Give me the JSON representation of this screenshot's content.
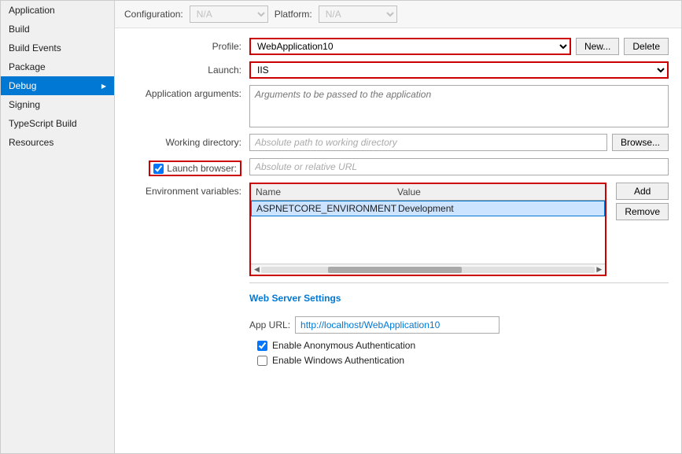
{
  "sidebar": {
    "items": [
      {
        "id": "application",
        "label": "Application",
        "active": false
      },
      {
        "id": "build",
        "label": "Build",
        "active": false
      },
      {
        "id": "build-events",
        "label": "Build Events",
        "active": false
      },
      {
        "id": "package",
        "label": "Package",
        "active": false
      },
      {
        "id": "debug",
        "label": "Debug",
        "active": true
      },
      {
        "id": "signing",
        "label": "Signing",
        "active": false
      },
      {
        "id": "typescript-build",
        "label": "TypeScript Build",
        "active": false
      },
      {
        "id": "resources",
        "label": "Resources",
        "active": false
      }
    ]
  },
  "topbar": {
    "configuration_label": "Configuration:",
    "configuration_value": "N/A",
    "platform_label": "Platform:",
    "platform_value": "N/A"
  },
  "form": {
    "profile_label": "Profile:",
    "profile_value": "WebApplication10",
    "profile_placeholder": "WebApplication10",
    "new_button": "New...",
    "delete_button": "Delete",
    "launch_label": "Launch:",
    "launch_value": "IIS",
    "app_args_label": "Application arguments:",
    "app_args_placeholder": "Arguments to be passed to the application",
    "working_dir_label": "Working directory:",
    "working_dir_placeholder": "Absolute path to working directory",
    "browse_button": "Browse...",
    "launch_browser_label": "Launch browser:",
    "launch_browser_checked": true,
    "launch_url_placeholder": "Absolute or relative URL",
    "env_vars_label": "Environment variables:",
    "env_table": {
      "name_col": "Name",
      "value_col": "Value",
      "rows": [
        {
          "name": "ASPNETCORE_ENVIRONMENT",
          "value": "Development",
          "selected": true
        }
      ]
    },
    "add_button": "Add",
    "remove_button": "Remove"
  },
  "web_server": {
    "heading": "Web Server Settings",
    "app_url_label": "App URL:",
    "app_url_value": "http://localhost/WebApplication10",
    "anon_auth_label": "Enable Anonymous Authentication",
    "anon_auth_checked": true,
    "windows_auth_label": "Enable Windows Authentication",
    "windows_auth_checked": false
  }
}
